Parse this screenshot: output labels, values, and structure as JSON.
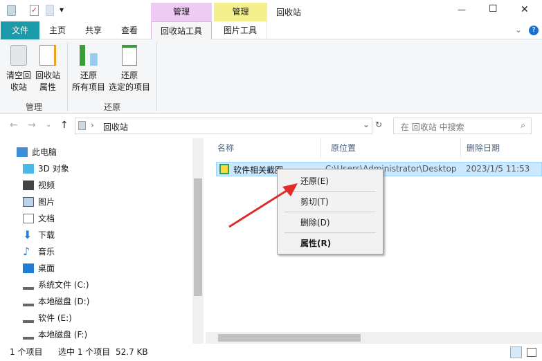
{
  "titlebar": {
    "title": "回收站",
    "context_tab_1": "管理",
    "context_tab_2": "管理",
    "qat_dropdown": "▾",
    "minimize": "—",
    "maximize": "☐",
    "close": "✕"
  },
  "tabs": {
    "file": "文件",
    "home": "主页",
    "share": "共享",
    "view": "查看",
    "recycle_tools": "回收站工具",
    "picture_tools": "图片工具",
    "help": "?",
    "collapse": "⌄"
  },
  "ribbon": {
    "empty_bin": [
      "清空回",
      "收站"
    ],
    "bin_props": [
      "回收站",
      "属性"
    ],
    "group_manage": "管理",
    "restore_all": [
      "还原",
      "所有项目"
    ],
    "restore_selected": [
      "还原",
      "选定的项目"
    ],
    "group_restore": "还原"
  },
  "address": {
    "path": "回收站",
    "search_placeholder": "在 回收站 中搜索"
  },
  "nav": {
    "items": [
      "此电脑",
      "3D 对象",
      "视频",
      "图片",
      "文档",
      "下载",
      "音乐",
      "桌面",
      "系统文件 (C:)",
      "本地磁盘 (D:)",
      "软件 (E:)",
      "本地磁盘 (F:)"
    ]
  },
  "columns": {
    "name": "名称",
    "location": "原位置",
    "date": "删除日期"
  },
  "file": {
    "name": "软件相关截图",
    "location": "C:\\Users\\Administrator\\Desktop",
    "date": "2023/1/5 11:53"
  },
  "menu": {
    "restore": "还原(E)",
    "cut": "剪切(T)",
    "delete": "删除(D)",
    "properties": "属性(R)"
  },
  "status": {
    "count": "1 个项目",
    "selected": "选中 1 个项目",
    "size": "52.7 KB"
  },
  "colors": {
    "file_tab": "#1b9aaa",
    "ctx1": "#eecbf3",
    "ctx2": "#f5f08e",
    "arrow": "#e02b2b"
  }
}
